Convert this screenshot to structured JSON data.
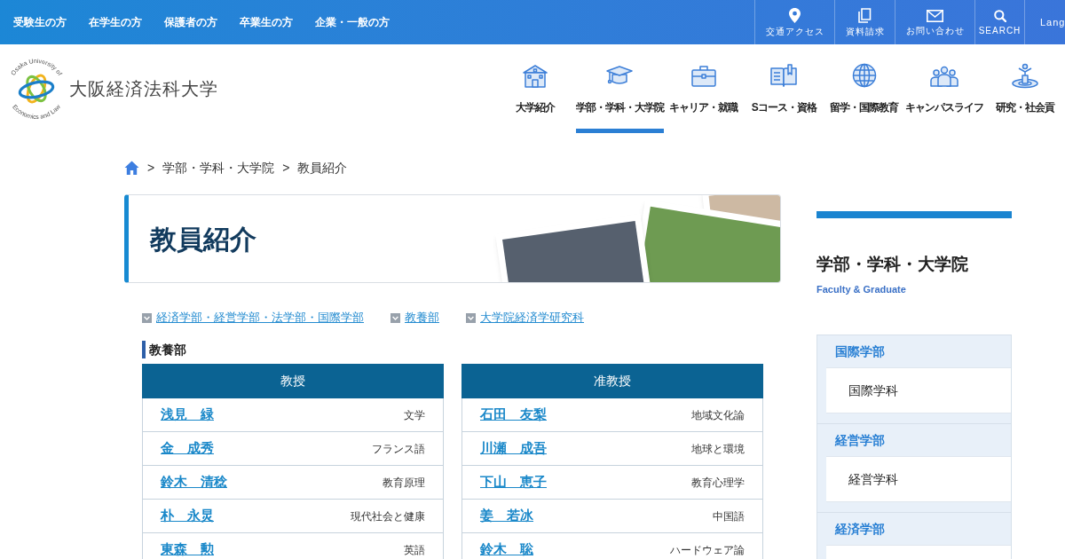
{
  "top_bar": {
    "audience_links": [
      "受験生の方",
      "在学生の方",
      "保護者の方",
      "卒業生の方",
      "企業・一般の方"
    ],
    "utility_links": [
      {
        "kind": "pin",
        "label": "交通アクセス"
      },
      {
        "kind": "document",
        "label": "資料請求"
      },
      {
        "kind": "mail",
        "label": "お問い合わせ"
      },
      {
        "kind": "search",
        "label": "SEARCH"
      }
    ],
    "language": "Lang"
  },
  "header": {
    "logo": {
      "motto_top": "Osaka University of",
      "motto_bottom": "Economics and Law",
      "name": "大阪経済法科大学"
    },
    "nav": [
      {
        "kind": "building",
        "label": "大学紹介",
        "selected": false
      },
      {
        "kind": "mortarboard",
        "label": "学部・学科・大学院",
        "selected": true
      },
      {
        "kind": "briefcase",
        "label": "キャリア・就職",
        "selected": false
      },
      {
        "kind": "book",
        "label": "Sコース・資格",
        "selected": false
      },
      {
        "kind": "globe",
        "label": "留学・国際教育",
        "selected": false
      },
      {
        "kind": "people",
        "label": "キャンパスライフ",
        "selected": false
      },
      {
        "kind": "podium",
        "label": "研究・社会貢",
        "selected": false
      }
    ]
  },
  "breadcrumb": [
    {
      "separator": ">",
      "label": "学部・学科・大学院"
    },
    {
      "separator": ">",
      "label": "教員紹介"
    }
  ],
  "page_title": "教員紹介",
  "section_links": [
    "経済学部・経営学部・法学部・国際学部",
    "教養部",
    "大学院経済学研究科"
  ],
  "section": {
    "heading": "教養部",
    "tables": [
      {
        "title": "教授",
        "rows": [
          {
            "name": "浅見　緑",
            "subject": "文学"
          },
          {
            "name": "金　成秀",
            "subject": "フランス語"
          },
          {
            "name": "鈴木　清稔",
            "subject": "教育原理"
          },
          {
            "name": "朴　永炅",
            "subject": "現代社会と健康"
          },
          {
            "name": "東森　勲",
            "subject": "英語"
          }
        ]
      },
      {
        "title": "准教授",
        "rows": [
          {
            "name": "石田　友梨",
            "subject": "地域文化論"
          },
          {
            "name": "川瀬　成吾",
            "subject": "地球と環境"
          },
          {
            "name": "下山　恵子",
            "subject": "教育心理学"
          },
          {
            "name": "姜　若冰",
            "subject": "中国語"
          },
          {
            "name": "鈴木　聡",
            "subject": "ハードウェア論"
          }
        ]
      }
    ]
  },
  "sidebar": {
    "title": "学部・学科・大学院",
    "subtitle": "Faculty & Graduate",
    "groups": [
      {
        "label": "国際学部",
        "children": [
          "国際学科"
        ]
      },
      {
        "label": "経営学部",
        "children": [
          "経営学科"
        ]
      },
      {
        "label": "経済学部"
      }
    ]
  }
}
